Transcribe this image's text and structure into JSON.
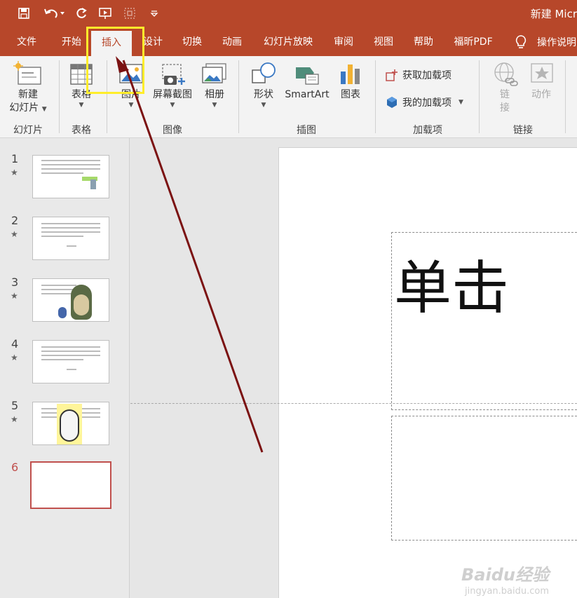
{
  "app": {
    "title": "新建 Micr"
  },
  "quick_access": [
    "save-icon",
    "undo-icon",
    "redo-icon",
    "present-icon",
    "fit-icon",
    "customize-icon"
  ],
  "tabs": [
    {
      "label": "文件"
    },
    {
      "label": "开始"
    },
    {
      "label": "插入"
    },
    {
      "label": "设计"
    },
    {
      "label": "切换"
    },
    {
      "label": "动画"
    },
    {
      "label": "幻灯片放映"
    },
    {
      "label": "审阅"
    },
    {
      "label": "视图"
    },
    {
      "label": "帮助"
    },
    {
      "label": "福昕PDF"
    }
  ],
  "active_tab": "插入",
  "tell_me": {
    "label": "操作说明"
  },
  "ribbon": {
    "new_slide": {
      "line1": "新建",
      "line2": "幻灯片"
    },
    "table": {
      "label": "表格"
    },
    "picture": {
      "label": "图片"
    },
    "screenshot": {
      "label": "屏幕截图"
    },
    "album": {
      "label": "相册"
    },
    "shapes": {
      "label": "形状"
    },
    "smartart": {
      "label": "SmartArt"
    },
    "chart": {
      "label": "图表"
    },
    "get_addins": {
      "label": "获取加载项"
    },
    "my_addins": {
      "label": "我的加载项"
    },
    "link": {
      "line1": "链",
      "line2": "接"
    },
    "action": {
      "label": "动作"
    },
    "groups": {
      "slides": "幻灯片",
      "tables": "表格",
      "images": "图像",
      "illustrations": "插图",
      "addins": "加载项",
      "links": "链接"
    }
  },
  "slides": [
    {
      "num": "1",
      "star": "★"
    },
    {
      "num": "2",
      "star": "★"
    },
    {
      "num": "3",
      "star": "★"
    },
    {
      "num": "4",
      "star": "★"
    },
    {
      "num": "5",
      "star": "★"
    },
    {
      "num": "6",
      "star": ""
    }
  ],
  "active_slide": "6",
  "canvas": {
    "title_text": "单击"
  },
  "watermark": {
    "brand": "Baidu经验",
    "url": "jingyan.baidu.com"
  },
  "colors": {
    "accent": "#b7472a",
    "highlight": "#ffed2b",
    "arrow": "#7b1212"
  }
}
